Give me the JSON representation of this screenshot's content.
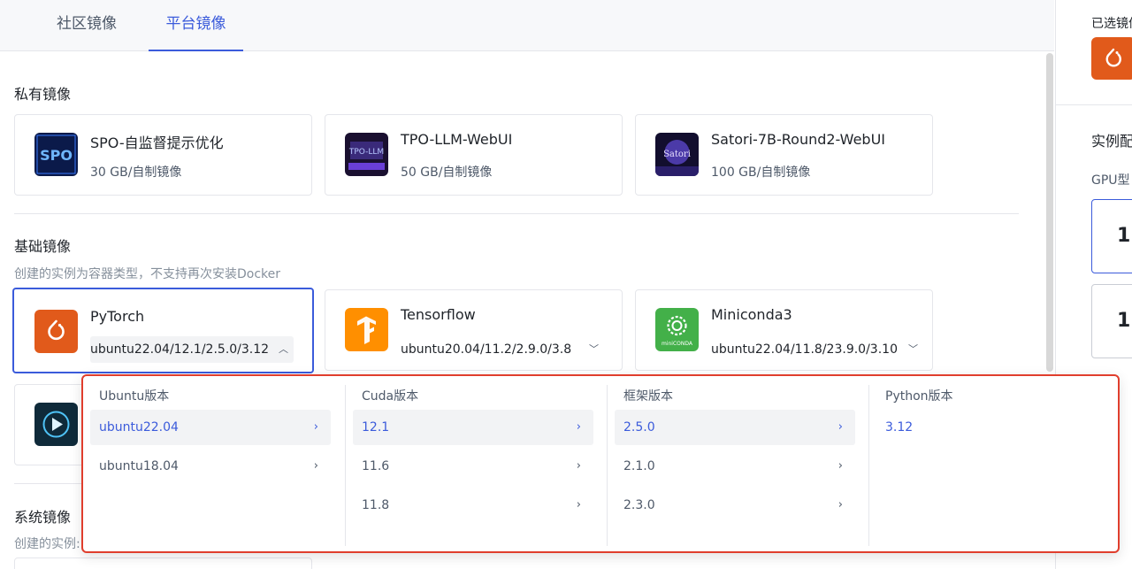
{
  "tabs": [
    "社区镜像",
    "平台镜像"
  ],
  "private": {
    "title": "私有镜像",
    "items": [
      {
        "name": "SPO-自监督提示优化",
        "meta": "30 GB/自制镜像"
      },
      {
        "name": "TPO-LLM-WebUI",
        "meta": "50 GB/自制镜像"
      },
      {
        "name": "Satori-7B-Round2-WebUI",
        "meta": "100 GB/自制镜像"
      }
    ]
  },
  "base": {
    "title": "基础镜像",
    "desc": "创建的实例为容器类型，不支持再次安装Docker",
    "items": [
      {
        "name": "PyTorch",
        "version": "ubuntu22.04/12.1/2.5.0/3.12",
        "icon": "pytorch-icon"
      },
      {
        "name": "Tensorflow",
        "version": "ubuntu20.04/11.2/2.9.0/3.8",
        "icon": "tensorflow-icon"
      },
      {
        "name": "Miniconda3",
        "version": "ubuntu22.04/11.8/23.9.0/3.10",
        "icon": "miniconda-icon"
      }
    ]
  },
  "system": {
    "title": "系统镜像",
    "desc": "创建的实例:"
  },
  "dropdown": {
    "columns": [
      {
        "head": "Ubuntu版本",
        "options": [
          "ubuntu22.04",
          "ubuntu18.04"
        ],
        "active": 0,
        "arrows": true
      },
      {
        "head": "Cuda版本",
        "options": [
          "12.1",
          "11.6",
          "11.8"
        ],
        "active": 0,
        "arrows": true
      },
      {
        "head": "框架版本",
        "options": [
          "2.5.0",
          "2.1.0",
          "2.3.0"
        ],
        "active": 0,
        "arrows": true
      },
      {
        "head": "Python版本",
        "options": [
          "3.12"
        ],
        "active": 0,
        "arrows": false
      }
    ]
  },
  "right_panel": {
    "selected_label": "已选镜像",
    "instance_label": "实例配",
    "gpu_label": "GPU型",
    "gpu_card_1": "1",
    "gpu_card_2": "1"
  },
  "colors": {
    "accent": "#3b5bdb",
    "pytorch": "#e15a1b",
    "tensorflow": "#ff8f00",
    "miniconda": "#43b049",
    "highlight_border": "#e03e2d"
  }
}
